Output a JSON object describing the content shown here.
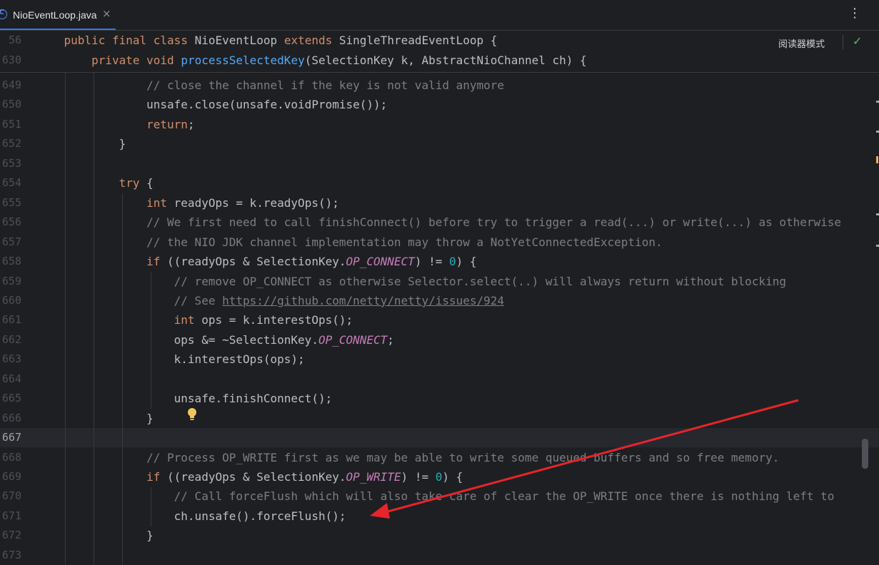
{
  "tab": {
    "filename": "NioEventLoop.java",
    "icon": "C",
    "close": "×"
  },
  "menu_icon": "⋮",
  "reader_mode": "阅读器模式",
  "check_icon": "✓",
  "sticky_lines": [
    {
      "num": "56",
      "parts": [
        {
          "t": "    "
        },
        {
          "t": "public",
          "c": "kw"
        },
        {
          "t": " "
        },
        {
          "t": "final",
          "c": "kw"
        },
        {
          "t": " "
        },
        {
          "t": "class",
          "c": "kw"
        },
        {
          "t": " NioEventLoop "
        },
        {
          "t": "extends",
          "c": "kw"
        },
        {
          "t": " SingleThreadEventLoop {"
        }
      ]
    },
    {
      "num": "630",
      "parts": [
        {
          "t": "        "
        },
        {
          "t": "private",
          "c": "kw"
        },
        {
          "t": " "
        },
        {
          "t": "void",
          "c": "kw"
        },
        {
          "t": " "
        },
        {
          "t": "processSelectedKey",
          "c": "fn"
        },
        {
          "t": "(SelectionKey k, AbstractNioChannel ch) {"
        }
      ]
    }
  ],
  "lines": [
    {
      "num": "649",
      "parts": [
        {
          "t": "                // close the channel if the key is not valid anymore",
          "c": "cm"
        }
      ]
    },
    {
      "num": "650",
      "parts": [
        {
          "t": "                unsafe.close(unsafe.voidPromise());"
        }
      ]
    },
    {
      "num": "651",
      "parts": [
        {
          "t": "                "
        },
        {
          "t": "return",
          "c": "kw"
        },
        {
          "t": ";"
        }
      ]
    },
    {
      "num": "652",
      "parts": [
        {
          "t": "            }"
        }
      ]
    },
    {
      "num": "653",
      "parts": [
        {
          "t": ""
        }
      ]
    },
    {
      "num": "654",
      "parts": [
        {
          "t": "            "
        },
        {
          "t": "try",
          "c": "kw"
        },
        {
          "t": " {"
        }
      ]
    },
    {
      "num": "655",
      "parts": [
        {
          "t": "                "
        },
        {
          "t": "int",
          "c": "kw"
        },
        {
          "t": " readyOps = k.readyOps();"
        }
      ]
    },
    {
      "num": "656",
      "parts": [
        {
          "t": "                // We first need to call finishConnect() before try to trigger a read(...) or write(...) as otherwise",
          "c": "cm"
        }
      ]
    },
    {
      "num": "657",
      "parts": [
        {
          "t": "                // the NIO JDK channel implementation may throw a NotYetConnectedException.",
          "c": "cm"
        }
      ]
    },
    {
      "num": "658",
      "parts": [
        {
          "t": "                "
        },
        {
          "t": "if",
          "c": "kw"
        },
        {
          "t": " ((readyOps & SelectionKey."
        },
        {
          "t": "OP_CONNECT",
          "c": "st"
        },
        {
          "t": ") != "
        },
        {
          "t": "0",
          "c": "nm"
        },
        {
          "t": ") {"
        }
      ]
    },
    {
      "num": "659",
      "parts": [
        {
          "t": "                    // remove OP_CONNECT as otherwise Selector.select(..) will always return without blocking",
          "c": "cm"
        }
      ]
    },
    {
      "num": "660",
      "parts": [
        {
          "t": "                    // See ",
          "c": "cm"
        },
        {
          "t": "https://github.com/netty/netty/issues/924",
          "c": "ln"
        }
      ]
    },
    {
      "num": "661",
      "parts": [
        {
          "t": "                    "
        },
        {
          "t": "int",
          "c": "kw"
        },
        {
          "t": " ops = k.interestOps();"
        }
      ]
    },
    {
      "num": "662",
      "parts": [
        {
          "t": "                    ops &= ~SelectionKey."
        },
        {
          "t": "OP_CONNECT",
          "c": "st"
        },
        {
          "t": ";"
        }
      ]
    },
    {
      "num": "663",
      "parts": [
        {
          "t": "                    k.interestOps(ops);"
        }
      ]
    },
    {
      "num": "664",
      "parts": [
        {
          "t": ""
        }
      ]
    },
    {
      "num": "665",
      "parts": [
        {
          "t": "                    unsafe.finishConnect();"
        }
      ]
    },
    {
      "num": "666",
      "parts": [
        {
          "t": "                }"
        }
      ]
    },
    {
      "num": "667",
      "current": true,
      "parts": [
        {
          "t": ""
        }
      ]
    },
    {
      "num": "668",
      "parts": [
        {
          "t": "                // Process OP_WRITE first as we may be able to write some queued buffers and so free memory.",
          "c": "cm"
        }
      ]
    },
    {
      "num": "669",
      "parts": [
        {
          "t": "                "
        },
        {
          "t": "if",
          "c": "kw"
        },
        {
          "t": " ((readyOps & SelectionKey."
        },
        {
          "t": "OP_WRITE",
          "c": "st"
        },
        {
          "t": ") != "
        },
        {
          "t": "0",
          "c": "nm"
        },
        {
          "t": ") {"
        }
      ]
    },
    {
      "num": "670",
      "parts": [
        {
          "t": "                    // Call forceFlush which will also take care of clear the OP_WRITE once there is nothing left to",
          "c": "cm"
        }
      ]
    },
    {
      "num": "671",
      "parts": [
        {
          "t": "                    ch.unsafe().forceFlush();"
        }
      ]
    },
    {
      "num": "672",
      "parts": [
        {
          "t": "                }"
        }
      ]
    },
    {
      "num": "673",
      "parts": [
        {
          "t": ""
        }
      ]
    }
  ],
  "colors": {
    "background": "#1e1f22",
    "keyword": "#cf8e6d",
    "function": "#56a8f5",
    "comment": "#7a7e85",
    "static_field": "#c77dbb",
    "number": "#2aacb8",
    "arrow": "#e5252a"
  }
}
